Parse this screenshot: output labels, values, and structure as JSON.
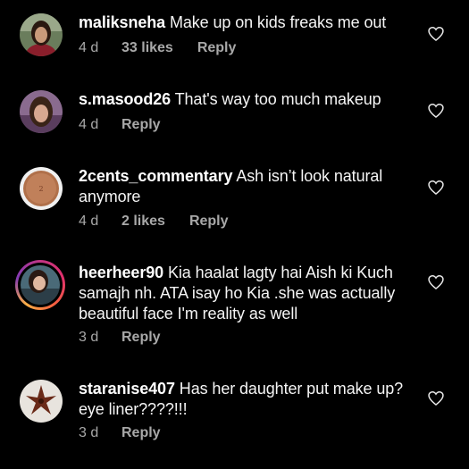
{
  "comments": [
    {
      "username": "maliksneha",
      "text": "Make up on kids freaks me out",
      "time": "4 d",
      "likes": "33 likes",
      "reply": "Reply"
    },
    {
      "username": "s.masood26",
      "text": "That's way too much makeup",
      "time": "4 d",
      "likes": "",
      "reply": "Reply"
    },
    {
      "username": "2cents_commentary",
      "text": "Ash isn’t look natural anymore",
      "time": "4 d",
      "likes": "2 likes",
      "reply": "Reply"
    },
    {
      "username": "heerheer90",
      "text": "Kia haalat lagty hai Aish ki Kuch samajh nh. ATA isay ho Kia .she was actually beautiful face I'm reality as well",
      "time": "3 d",
      "likes": "",
      "reply": "Reply"
    },
    {
      "username": "staranise407",
      "text": "Has her daughter put make up?eye liner????!!!",
      "time": "3 d",
      "likes": "",
      "reply": "Reply"
    }
  ],
  "icons": {
    "like": "heart-outline-icon"
  },
  "colors": {
    "background": "#000000",
    "text": "#f5f5f5",
    "secondary": "#a8a8a8"
  }
}
